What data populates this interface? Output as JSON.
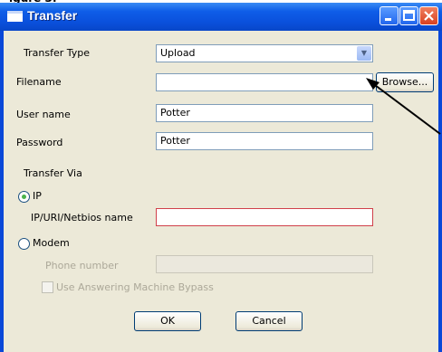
{
  "window": {
    "title": "Transfer"
  },
  "form": {
    "transfer_type_label": "Transfer Type",
    "transfer_type_value": "Upload",
    "filename_label": "Filename",
    "filename_value": "",
    "browse_label": "Browse...",
    "username_label": "User name",
    "username_value": "Potter",
    "password_label": "Password",
    "password_value": "Potter",
    "transfer_via_label": "Transfer Via",
    "ip_radio_label": "IP",
    "ip_field_label": "IP/URI/Netbios name",
    "ip_field_value": "",
    "modem_radio_label": "Modem",
    "phone_label": "Phone number",
    "phone_value": "",
    "bypass_label": "Use Answering Machine Bypass"
  },
  "buttons": {
    "ok": "OK",
    "cancel": "Cancel"
  },
  "selected_transfer_via": "IP"
}
